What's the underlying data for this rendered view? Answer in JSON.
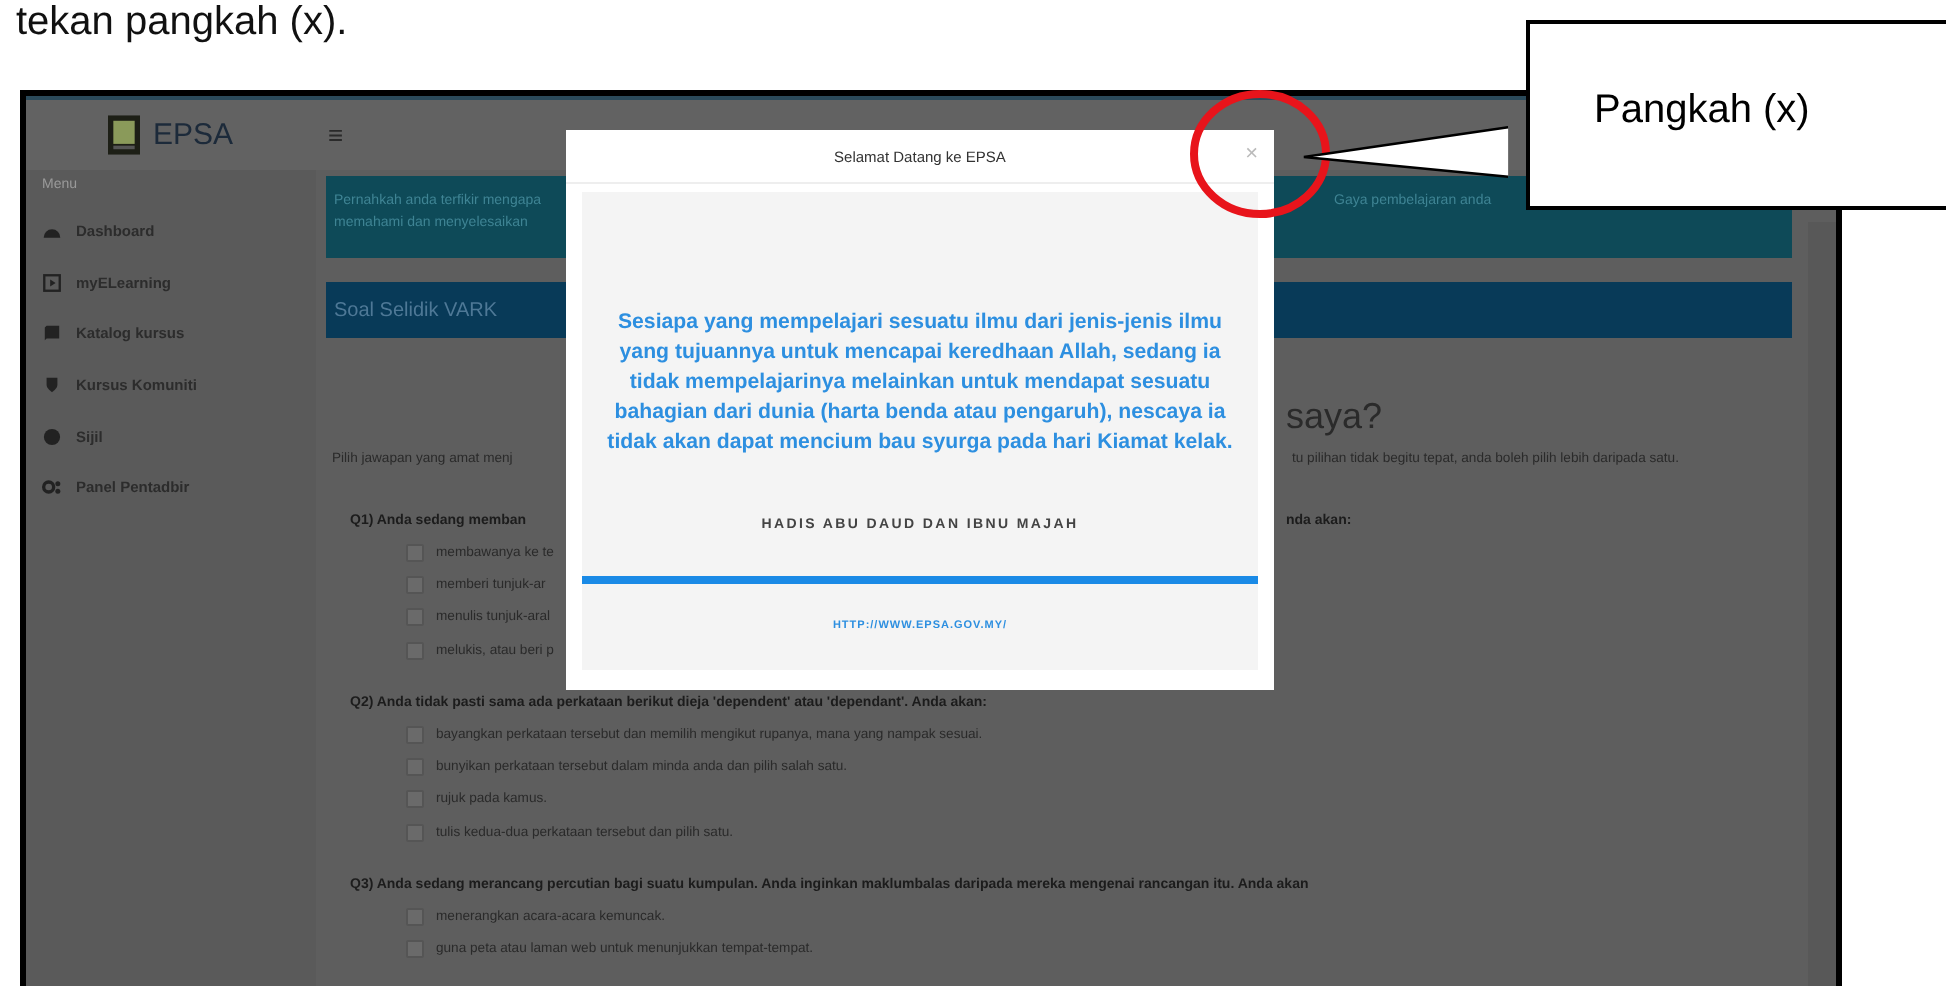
{
  "instruction_text": "tekan pangkah (x).",
  "app": {
    "brand": "EPSA",
    "menu_icon": "≡",
    "sidebar": {
      "heading": "Menu",
      "items": [
        {
          "label": "Dashboard"
        },
        {
          "label": "myELearning"
        },
        {
          "label": "Katalog kursus"
        },
        {
          "label": "Kursus Komuniti"
        },
        {
          "label": "Sijil"
        },
        {
          "label": "Panel Pentadbir"
        }
      ]
    },
    "banner": {
      "lines": [
        {
          "left": "Pernahkah anda terfikir mengapa",
          "right": "Gaya pembelajaran anda"
        },
        {
          "left": "memahami dan menyelesaikan"
        }
      ]
    },
    "section_title": "Soal Selidik VARK",
    "heading_fragment": "saya?",
    "instruction": {
      "left": "Pilih jawapan yang amat menj",
      "right": "tu pilihan tidak begitu tepat, anda boleh pilih lebih daripada satu."
    },
    "questions": [
      {
        "left": "Q1) Anda sedang memban",
        "right": "nda akan:",
        "options": [
          {
            "text": "membawanya ke te",
            "checked": false
          },
          {
            "text": "memberi tunjuk-ar",
            "checked": false
          },
          {
            "text": "menulis tunjuk-aral",
            "checked": false
          },
          {
            "text": "melukis, atau beri p",
            "checked": false
          }
        ]
      },
      {
        "text": "Q2) Anda tidak pasti sama ada perkataan berikut dieja 'dependent' atau 'dependant'. Anda akan:",
        "options": [
          {
            "text": "bayangkan perkataan tersebut dan memilih mengikut rupanya, mana yang nampak sesuai.",
            "checked": false
          },
          {
            "text": "bunyikan perkataan tersebut dalam minda anda dan pilih salah satu.",
            "checked": false
          },
          {
            "text": "rujuk pada kamus.",
            "checked": false
          },
          {
            "text": "tulis kedua-dua perkataan tersebut dan pilih satu.",
            "checked": false
          }
        ]
      },
      {
        "text": "Q3) Anda sedang merancang percutian bagi suatu kumpulan. Anda inginkan maklumbalas daripada mereka mengenai rancangan itu. Anda akan",
        "options": [
          {
            "text": "menerangkan acara-acara kemuncak.",
            "checked": false
          },
          {
            "text": "guna peta atau laman web untuk menunjukkan tempat-tempat.",
            "checked": false
          }
        ]
      }
    ],
    "modal": {
      "title": "Selamat Datang ke EPSA",
      "close": "×",
      "quote": "Sesiapa yang mempelajari sesuatu ilmu dari jenis-jenis ilmu yang tujuannya untuk mencapai keredhaan Allah, sedang ia tidak mempelajarinya melainkan untuk mendapat sesuatu bahagian dari dunia (harta benda atau pengaruh), nescaya ia tidak akan dapat mencium bau syurga pada hari Kiamat kelak.",
      "source": "HADIS ABU DAUD DAN IBNU MAJAH",
      "link": "HTTP://WWW.EPSA.GOV.MY/"
    }
  },
  "callout": {
    "label": "Pangkah (x)"
  }
}
